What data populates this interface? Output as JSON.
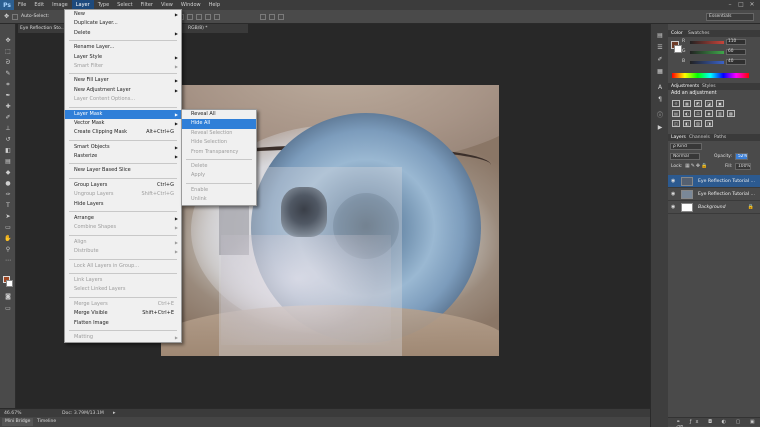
{
  "app": {
    "logo": "Ps",
    "menus": [
      "File",
      "Edit",
      "Image",
      "Layer",
      "Type",
      "Select",
      "Filter",
      "View",
      "Window",
      "Help"
    ],
    "window_controls": [
      "–",
      "□",
      "✕"
    ]
  },
  "options_bar": {
    "auto_select_label": "Auto-Select:",
    "workspace": "Essentials"
  },
  "document": {
    "tab_title": "Eye Reflection Sto...",
    "tab_suffix": "RGB/8) *"
  },
  "layer_menu": {
    "items": [
      {
        "label": "New",
        "arrow": true
      },
      {
        "label": "Duplicate Layer..."
      },
      {
        "label": "Delete",
        "arrow": true
      },
      {
        "sep": true
      },
      {
        "label": "Rename Layer..."
      },
      {
        "label": "Layer Style",
        "arrow": true
      },
      {
        "label": "Smart Filter",
        "arrow": true,
        "disabled": true
      },
      {
        "sep": true
      },
      {
        "label": "New Fill Layer",
        "arrow": true
      },
      {
        "label": "New Adjustment Layer",
        "arrow": true
      },
      {
        "label": "Layer Content Options...",
        "disabled": true
      },
      {
        "sep": true
      },
      {
        "label": "Layer Mask",
        "arrow": true,
        "highlight": true
      },
      {
        "label": "Vector Mask",
        "arrow": true
      },
      {
        "label": "Create Clipping Mask",
        "shortcut": "Alt+Ctrl+G"
      },
      {
        "sep": true
      },
      {
        "label": "Smart Objects",
        "arrow": true
      },
      {
        "label": "Rasterize",
        "arrow": true
      },
      {
        "sep": true
      },
      {
        "label": "New Layer Based Slice"
      },
      {
        "sep": true
      },
      {
        "label": "Group Layers",
        "shortcut": "Ctrl+G"
      },
      {
        "label": "Ungroup Layers",
        "shortcut": "Shift+Ctrl+G",
        "disabled": true
      },
      {
        "label": "Hide Layers"
      },
      {
        "sep": true
      },
      {
        "label": "Arrange",
        "arrow": true
      },
      {
        "label": "Combine Shapes",
        "arrow": true,
        "disabled": true
      },
      {
        "sep": true
      },
      {
        "label": "Align",
        "arrow": true,
        "disabled": true
      },
      {
        "label": "Distribute",
        "arrow": true,
        "disabled": true
      },
      {
        "sep": true
      },
      {
        "label": "Lock All Layers in Group...",
        "disabled": true
      },
      {
        "sep": true
      },
      {
        "label": "Link Layers",
        "disabled": true
      },
      {
        "label": "Select Linked Layers",
        "disabled": true
      },
      {
        "sep": true
      },
      {
        "label": "Merge Layers",
        "shortcut": "Ctrl+E",
        "disabled": true
      },
      {
        "label": "Merge Visible",
        "shortcut": "Shift+Ctrl+E"
      },
      {
        "label": "Flatten Image"
      },
      {
        "sep": true
      },
      {
        "label": "Matting",
        "arrow": true,
        "disabled": true
      }
    ]
  },
  "layer_mask_submenu": {
    "items": [
      {
        "label": "Reveal All"
      },
      {
        "label": "Hide All",
        "highlight": true
      },
      {
        "label": "Reveal Selection",
        "disabled": true
      },
      {
        "label": "Hide Selection",
        "disabled": true
      },
      {
        "label": "From Transparency",
        "disabled": true
      },
      {
        "sep": true
      },
      {
        "label": "Delete",
        "disabled": true
      },
      {
        "label": "Apply",
        "disabled": true
      },
      {
        "sep": true
      },
      {
        "label": "Enable",
        "disabled": true
      },
      {
        "label": "Unlink",
        "disabled": true
      }
    ]
  },
  "status": {
    "zoom": "46.67%",
    "doc_size": "Doc: 3.79M/13.1M"
  },
  "bottom_tabs": [
    "Mini Bridge",
    "Timeline"
  ],
  "color_panel": {
    "tabs": [
      "Color",
      "Swatches"
    ],
    "channels": [
      {
        "label": "R",
        "value": "110",
        "color": "#c8443a"
      },
      {
        "label": "G",
        "value": "60",
        "color": "#3ea84a"
      },
      {
        "label": "B",
        "value": "40",
        "color": "#3a62c8"
      }
    ],
    "fg_color": "#6e3c28"
  },
  "adjustments_panel": {
    "tabs": [
      "Adjustments",
      "Styles"
    ],
    "title": "Add an adjustment",
    "icon_rows": [
      [
        "☼",
        "▦",
        "◩",
        "◪",
        "▣"
      ],
      [
        "▤",
        "◐",
        "⚖",
        "◉",
        "▥",
        "▩"
      ],
      [
        "◫",
        "◧",
        "▨",
        "◨"
      ]
    ]
  },
  "layers_panel": {
    "tabs": [
      "Layers",
      "Channels",
      "Paths"
    ],
    "kind_label": "ρ Kind",
    "blend_mode": "Normal",
    "opacity_label": "Opacity:",
    "opacity_value": "52%",
    "lock_label": "Lock:",
    "fill_label": "Fill:",
    "fill_value": "100%",
    "layers": [
      {
        "name": "Eye Reflection Tutorial ...",
        "selected": true
      },
      {
        "name": "Eye Reflection Tutorial ...",
        "selected": false
      },
      {
        "name": "Background",
        "selected": false,
        "italic": true,
        "locked": true
      }
    ]
  }
}
